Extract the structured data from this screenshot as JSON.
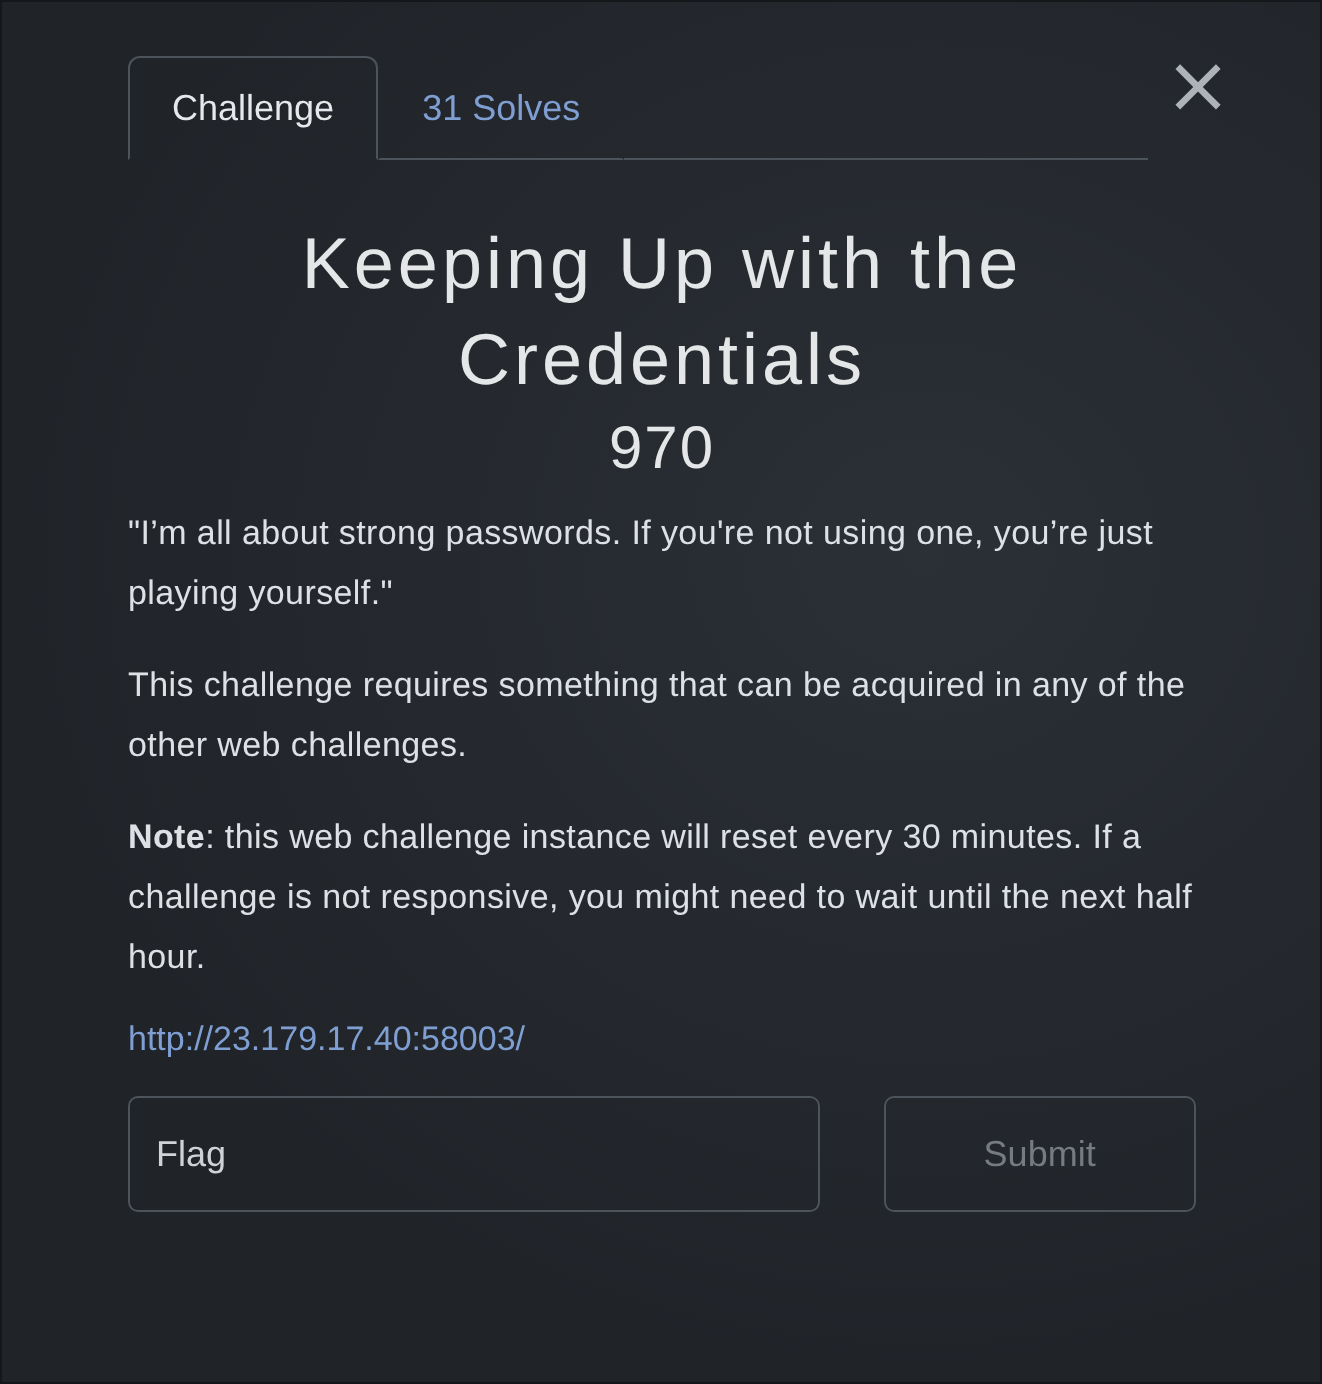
{
  "tabs": [
    {
      "label": "Challenge",
      "selected": true
    },
    {
      "label": "31 Solves",
      "selected": false
    }
  ],
  "close": "×",
  "title": "Keeping Up with the Credentials",
  "points": "970",
  "paragraphs": [
    "\"I’m all about strong passwords. If you're not using one, you’re just playing yourself.\"",
    "This challenge requires something that can be acquired in any of the other web challenges.",
    "**Note**: this web challenge instance will reset every 30 minutes. If a challenge is not responsive, you might need to wait until the next half hour."
  ],
  "link": "http://23.179.17.40:58003/",
  "flag_field": {
    "placeholder": "Flag"
  },
  "submit": {
    "label": "Submit",
    "disabled": true
  }
}
